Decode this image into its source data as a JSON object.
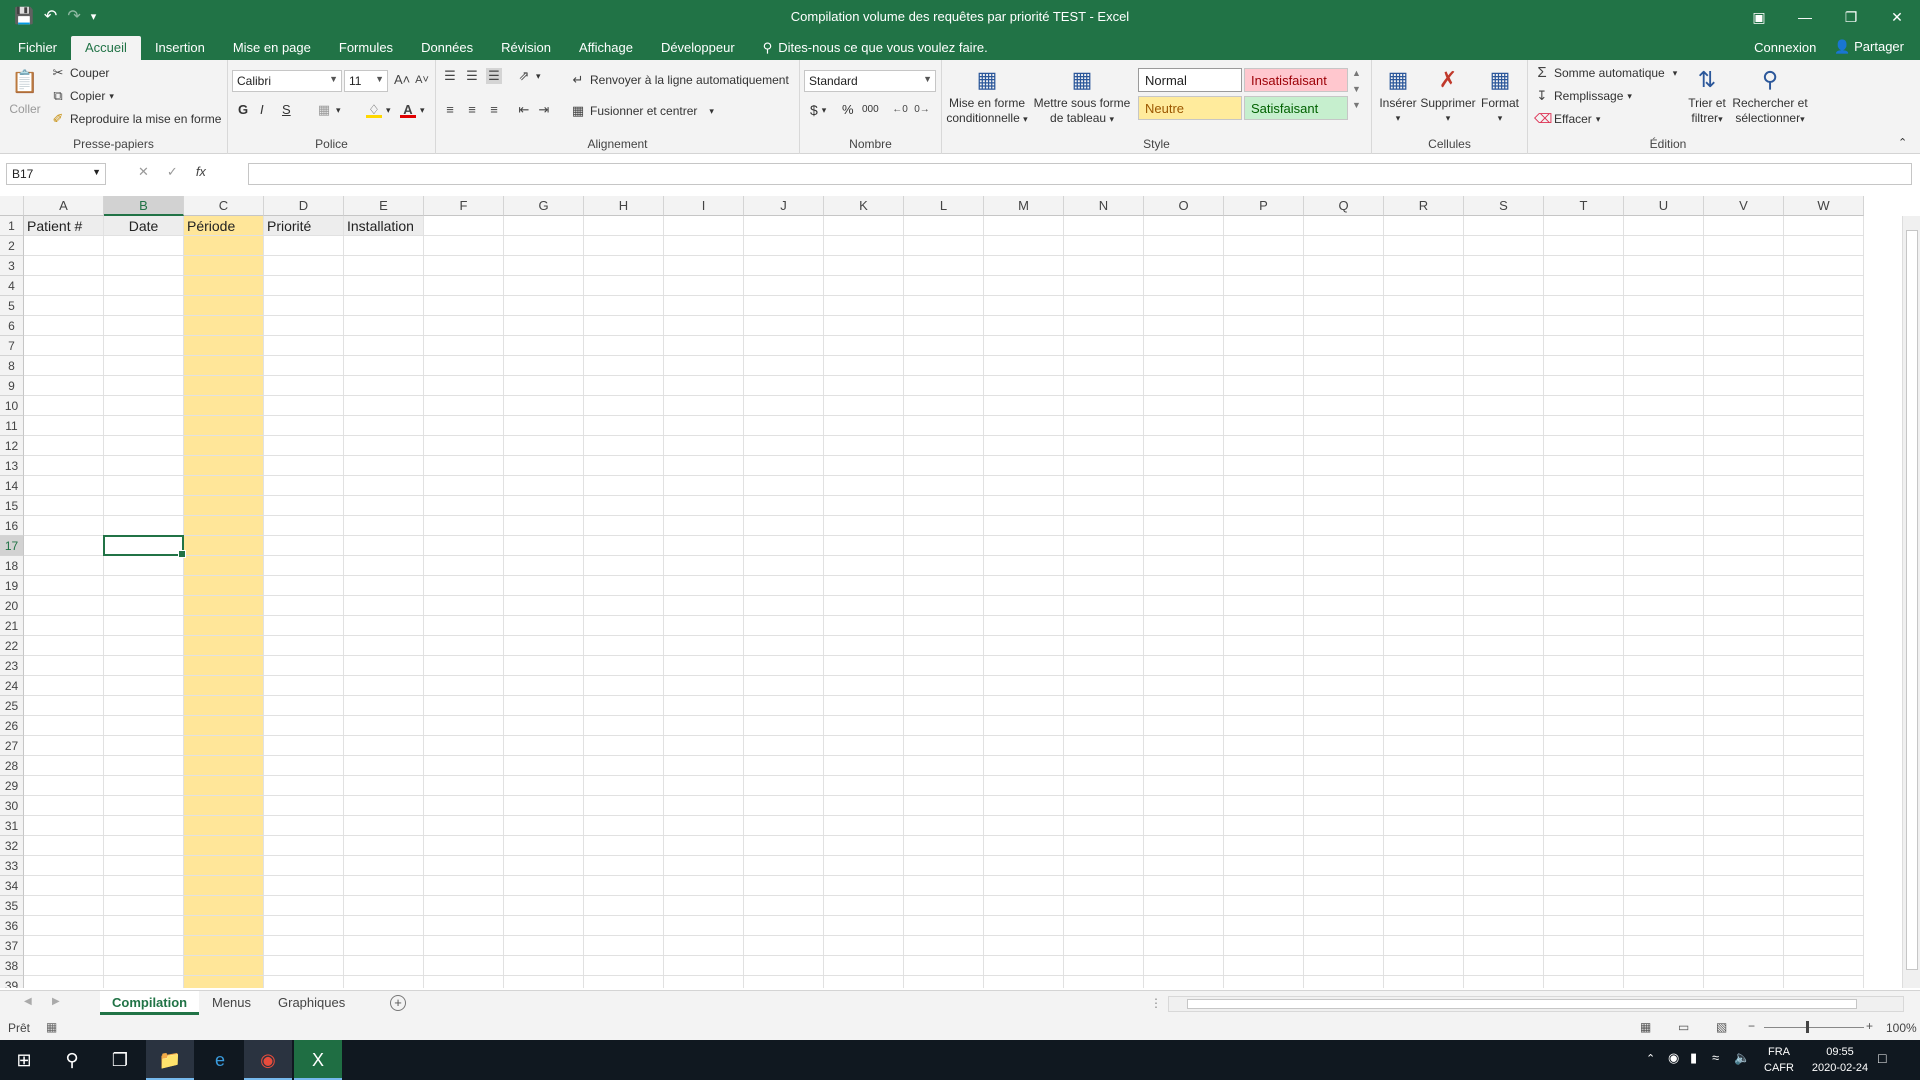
{
  "window": {
    "title": "Compilation volume des requêtes par priorité TEST - Excel",
    "qat_icons": [
      "save-icon",
      "undo-icon",
      "redo-icon",
      "customize-icon"
    ]
  },
  "menu": {
    "tabs": [
      "Fichier",
      "Accueil",
      "Insertion",
      "Mise en page",
      "Formules",
      "Données",
      "Révision",
      "Affichage",
      "Développeur"
    ],
    "active_tab": "Accueil",
    "tell_me": "Dites-nous ce que vous voulez faire.",
    "sign_in": "Connexion",
    "share": "Partager"
  },
  "ribbon": {
    "clipboard": {
      "label": "Presse-papiers",
      "paste": "Coller",
      "cut": "Couper",
      "copy": "Copier",
      "format_painter": "Reproduire la mise en forme"
    },
    "font": {
      "label": "Police",
      "name": "Calibri",
      "size": "11",
      "bold": "G",
      "italic": "I",
      "underline": "S"
    },
    "alignment": {
      "label": "Alignement",
      "wrap": "Renvoyer à la ligne automatiquement",
      "merge": "Fusionner et centrer"
    },
    "number": {
      "label": "Nombre",
      "format": "Standard",
      "currency": "$",
      "percent": "%",
      "thousands": "000"
    },
    "style": {
      "label": "Style",
      "conditional": [
        "Mise en forme",
        "conditionnelle"
      ],
      "as_table": [
        "Mettre sous forme",
        "de tableau"
      ],
      "normal": "Normal",
      "bad": "Insatisfaisant",
      "neutral": "Neutre",
      "good": "Satisfaisant"
    },
    "cells": {
      "label": "Cellules",
      "insert": "Insérer",
      "delete": "Supprimer",
      "format": "Format"
    },
    "editing": {
      "label": "Édition",
      "autosum": "Somme automatique",
      "fill": "Remplissage",
      "clear": "Effacer",
      "sort": [
        "Trier et",
        "filtrer"
      ],
      "find": [
        "Rechercher et",
        "sélectionner"
      ]
    }
  },
  "formula_bar": {
    "name_box": "B17",
    "fx": "fx",
    "value": ""
  },
  "sheet": {
    "columns": [
      "A",
      "B",
      "C",
      "D",
      "E",
      "F",
      "G",
      "H",
      "I",
      "J",
      "K",
      "L",
      "M",
      "N",
      "O",
      "P",
      "Q",
      "R",
      "S",
      "T",
      "U",
      "V",
      "W"
    ],
    "selected_column": "B",
    "selected_row": 17,
    "row_count": 39,
    "header_row": [
      "Patient #",
      "Date",
      "Période",
      "Priorité",
      "Installation"
    ],
    "highlight_column": "C",
    "colors": {
      "highlight": "#ffe699",
      "header_fill": "#ededed",
      "accent": "#217346"
    }
  },
  "sheet_tabs": {
    "tabs": [
      "Compilation",
      "Menus",
      "Graphiques"
    ],
    "active": "Compilation"
  },
  "status": {
    "ready": "Prêt",
    "zoom": "100%"
  },
  "taskbar": {
    "lang": "FRA",
    "region": "CAFR",
    "time": "09:55",
    "date": "2020-02-24"
  }
}
